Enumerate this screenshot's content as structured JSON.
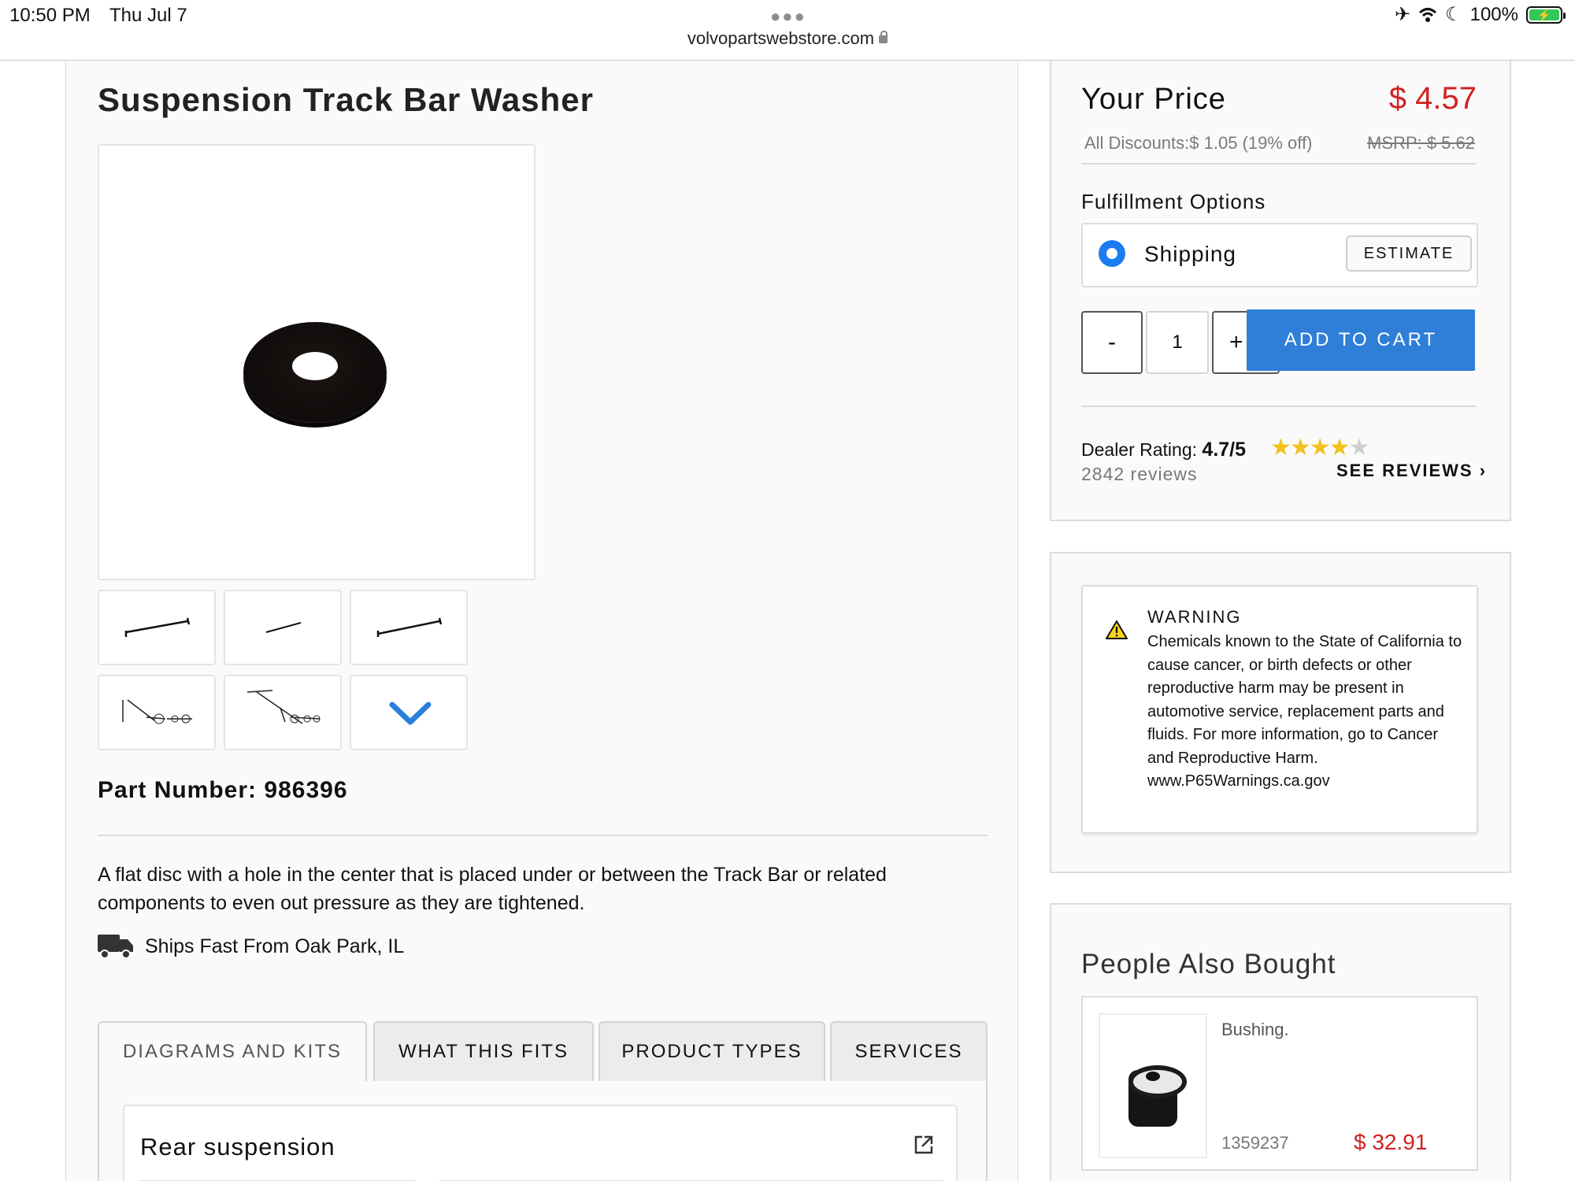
{
  "status_bar": {
    "time": "10:50 PM",
    "date": "Thu Jul 7",
    "battery": "100%"
  },
  "browser": {
    "url": "volvopartswebstore.com"
  },
  "product": {
    "title": "Suspension Track Bar Washer",
    "part_number_label": "Part Number:",
    "part_number": "986396",
    "description": "A flat disc with a hole in the center that is placed under or between the Track Bar or related components to even out pressure as they are tightened.",
    "ships_from": "Ships Fast From Oak Park, IL"
  },
  "tabs": [
    {
      "label": "DIAGRAMS AND KITS",
      "active": true
    },
    {
      "label": "WHAT THIS FITS",
      "active": false
    },
    {
      "label": "PRODUCT TYPES",
      "active": false
    },
    {
      "label": "SERVICES",
      "active": false
    }
  ],
  "diagram": {
    "title": "Rear suspension"
  },
  "pricing": {
    "your_price_label": "Your Price",
    "price": "$ 4.57",
    "discounts": "All Discounts:$ 1.05 (19% off)",
    "msrp": "MSRP: $ 5.62",
    "fulfillment_label": "Fulfillment Options",
    "shipping_label": "Shipping",
    "estimate_label": "ESTIMATE",
    "qty_minus": "-",
    "qty_value": "1",
    "qty_plus": "+",
    "add_to_cart": "ADD TO CART"
  },
  "rating": {
    "label": "Dealer Rating:",
    "value": "4.7/5",
    "stars_value": 4.7,
    "stars_max": 5,
    "reviews": "2842 reviews",
    "see_reviews": "SEE REVIEWS"
  },
  "warning": {
    "heading": "WARNING",
    "text": "Chemicals known to the State of California to cause cancer, or birth defects or other reproductive harm may be present in automotive service, replacement parts and fluids. For more information, go to Cancer and Reproductive Harm. www.P65Warnings.ca.gov"
  },
  "also_bought": {
    "title": "People Also Bought",
    "items": [
      {
        "name": "Bushing.",
        "part": "1359237",
        "price": "$ 32.91"
      }
    ]
  },
  "colors": {
    "price_red": "#d12121",
    "cart_blue": "#2f7ed8",
    "radio_blue": "#1a7cf0",
    "star_yellow": "#f2c21b"
  },
  "icons": {
    "airplane": "airplane-icon",
    "wifi": "wifi-icon",
    "moon": "moon-icon",
    "battery": "battery-icon",
    "lock": "lock-icon",
    "truck": "truck-icon",
    "warning": "warning-triangle-icon",
    "external": "external-link-icon",
    "chevron": "chevron-down-icon"
  }
}
